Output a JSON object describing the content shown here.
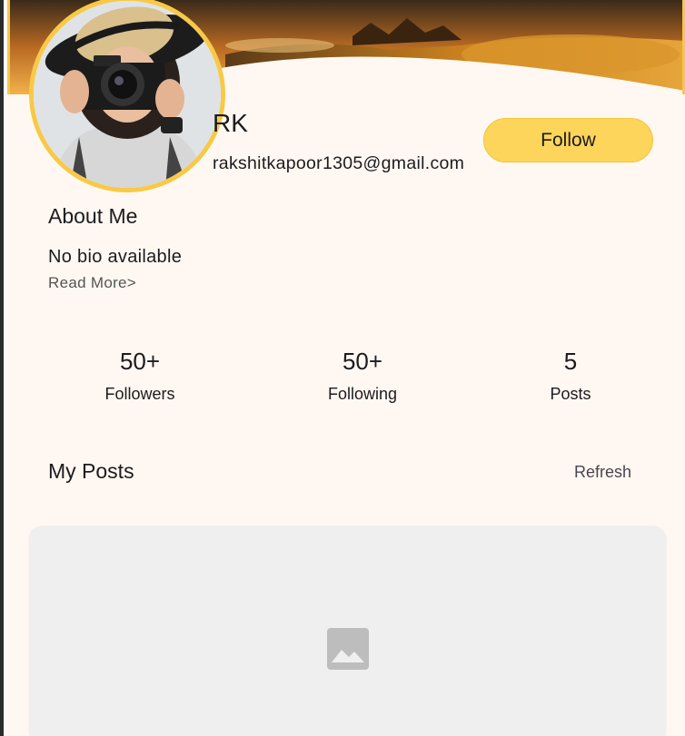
{
  "profile": {
    "name": "RK",
    "email": "rakshitkapoor1305@gmail.com",
    "follow_label": "Follow"
  },
  "about": {
    "title": "About Me",
    "bio": "No bio available",
    "read_more": "Read More>"
  },
  "stats": [
    {
      "value": "50+",
      "label": "Followers"
    },
    {
      "value": "50+",
      "label": "Following"
    },
    {
      "value": "5",
      "label": "Posts"
    }
  ],
  "posts": {
    "title": "My Posts",
    "refresh_label": "Refresh"
  },
  "colors": {
    "background": "#fff8f2",
    "accent": "#fdd55a",
    "avatar_ring": "#f8c946",
    "card": "#efefef"
  },
  "icons": {
    "post_placeholder": "image-placeholder-icon"
  }
}
